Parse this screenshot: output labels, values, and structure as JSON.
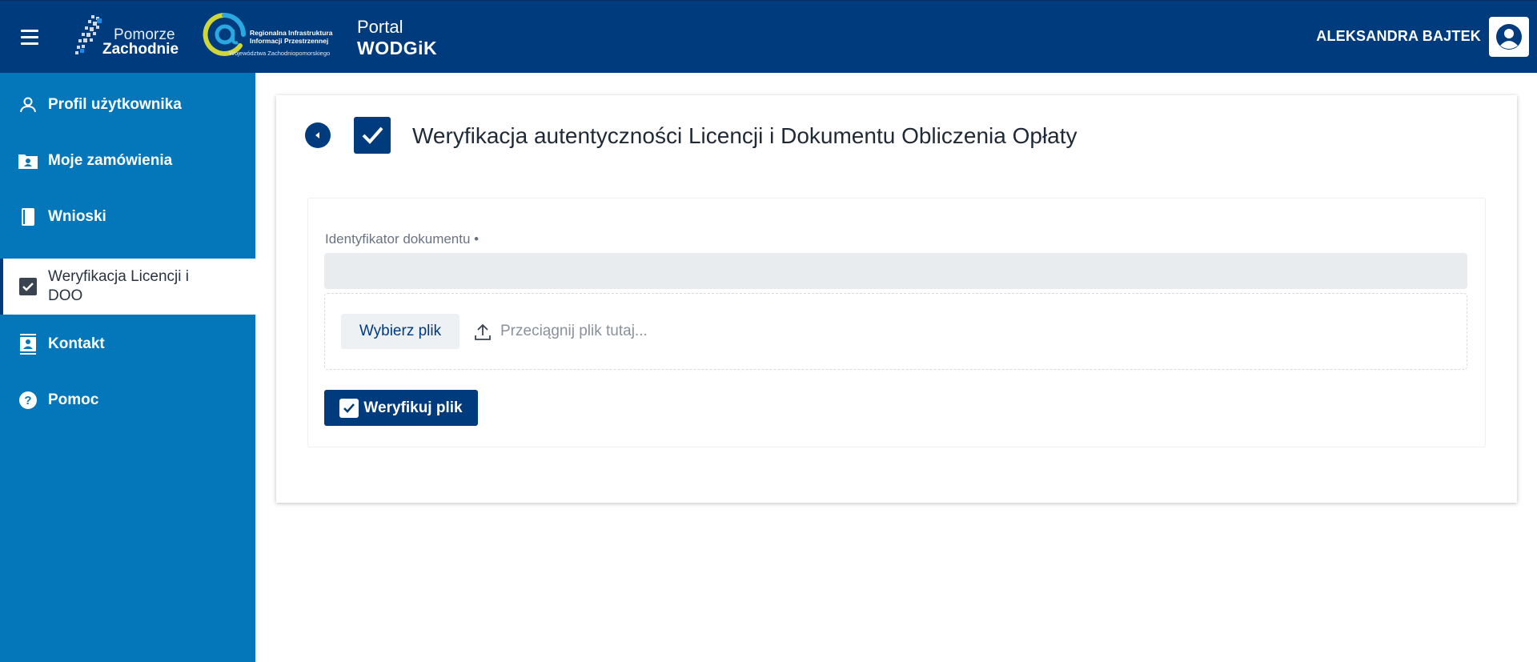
{
  "header": {
    "logo_pomorze_line1": "Pomorze",
    "logo_pomorze_line2": "Zachodnie",
    "riip_line1": "Regionalna Infrastruktura",
    "riip_line2": "Informacji Przestrzennej",
    "riip_line3": "Województwa Zachodniopomorskiego",
    "portal_line1": "Portal",
    "portal_line2": "WODGiK",
    "user_name": "ALEKSANDRA BAJTEK"
  },
  "sidebar": {
    "items": [
      {
        "label": "Profil użytkownika",
        "icon": "user-icon"
      },
      {
        "label": "Moje zamówienia",
        "icon": "folder-user-icon"
      },
      {
        "label": "Wnioski",
        "icon": "book-icon"
      },
      {
        "label": "Weryfikacja Licencji i DOO",
        "icon": "checkbox-icon",
        "active": true
      },
      {
        "label": "Kontakt",
        "icon": "contact-book-icon"
      },
      {
        "label": "Pomoc",
        "icon": "question-circle-icon"
      }
    ]
  },
  "main": {
    "title": "Weryfikacja autentyczności Licencji i Dokumentu Obliczenia Opłaty",
    "field_label": "Identyfikator dokumentu •",
    "field_value": "",
    "choose_file_label": "Wybierz plik",
    "drop_text": "Przeciągnij plik tutaj...",
    "verify_button_label": "Weryfikuj plik"
  },
  "colors": {
    "header_bg": "#003b7d",
    "sidebar_bg": "#0377b9",
    "accent": "#003b7d"
  }
}
